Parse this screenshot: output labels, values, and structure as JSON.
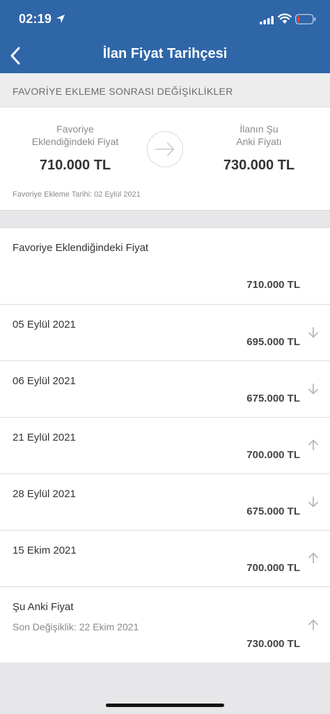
{
  "status": {
    "time": "02:19"
  },
  "header": {
    "title": "İlan Fiyat Tarihçesi"
  },
  "section": {
    "title": "FAVORİYE EKLEME SONRASI DEĞİŞİKLİKLER"
  },
  "summary": {
    "left_label": "Favoriye\nEklendiğindeki Fiyat",
    "left_value": "710.000 TL",
    "right_label": "İlanın Şu\nAnki Fiyatı",
    "right_value": "730.000 TL",
    "fav_date": "Favoriye Ekleme Tarihi: 02 Eylül 2021"
  },
  "history": [
    {
      "label": "Favoriye Eklendiğindeki Fiyat",
      "price": "710.000 TL"
    },
    {
      "label": "05 Eylül 2021",
      "price": "695.000 TL",
      "trend": "down"
    },
    {
      "label": "06 Eylül 2021",
      "price": "675.000 TL",
      "trend": "down"
    },
    {
      "label": "21 Eylül 2021",
      "price": "700.000 TL",
      "trend": "up"
    },
    {
      "label": "28 Eylül 2021",
      "price": "675.000 TL",
      "trend": "down"
    },
    {
      "label": "15 Ekim 2021",
      "price": "700.000 TL",
      "trend": "up"
    },
    {
      "label": "Şu Anki Fiyat",
      "sub": "Son Değişiklik: 22 Ekim 2021",
      "price": "730.000 TL",
      "trend": "up"
    }
  ],
  "colors": {
    "header_bg": "#2f66a8",
    "page_bg": "#e7e7e9",
    "trend_icon": "#b8b8bb"
  }
}
